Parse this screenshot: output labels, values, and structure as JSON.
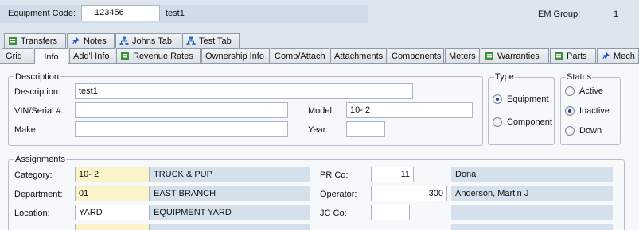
{
  "header": {
    "equipment_code_label": "Equipment Code:",
    "equipment_code_value": "123456",
    "equipment_name": "test1",
    "em_group_label": "EM Group:",
    "em_group_value": "1"
  },
  "tabs_row1": [
    {
      "label": "Transfers",
      "icon": "document-icon"
    },
    {
      "label": "Notes",
      "icon": "pin-icon"
    },
    {
      "label": "Johns Tab",
      "icon": "hierarchy-icon"
    },
    {
      "label": "Test Tab",
      "icon": "hierarchy-icon"
    }
  ],
  "tabs_row2": [
    {
      "label": "Grid",
      "icon": ""
    },
    {
      "label": "Info",
      "icon": "",
      "active": true
    },
    {
      "label": "Add'l Info",
      "icon": ""
    },
    {
      "label": "Revenue Rates",
      "icon": "document-icon"
    },
    {
      "label": "Ownership Info",
      "icon": ""
    },
    {
      "label": "Comp/Attach",
      "icon": ""
    },
    {
      "label": "Attachments",
      "icon": ""
    },
    {
      "label": "Components",
      "icon": ""
    },
    {
      "label": "Meters",
      "icon": ""
    },
    {
      "label": "Warranties",
      "icon": "document-icon"
    },
    {
      "label": "Parts",
      "icon": "document-icon"
    },
    {
      "label": "Mech",
      "icon": "pin-icon"
    }
  ],
  "description_section": {
    "title": "Description",
    "description_label": "Description:",
    "description_value": "test1",
    "vin_label": "VIN/Serial #:",
    "vin_value": "",
    "make_label": "Make:",
    "make_value": "",
    "model_label": "Model:",
    "model_value": "10-  2",
    "year_label": "Year:",
    "year_value": ""
  },
  "type_section": {
    "title": "Type",
    "options": [
      {
        "label": "Equipment",
        "selected": true
      },
      {
        "label": "Component",
        "selected": false
      }
    ]
  },
  "status_section": {
    "title": "Status",
    "options": [
      {
        "label": "Active",
        "selected": false
      },
      {
        "label": "Inactive",
        "selected": true
      },
      {
        "label": "Down",
        "selected": false
      }
    ]
  },
  "assignments": {
    "title": "Assignments",
    "category_label": "Category:",
    "category_value": "10-  2",
    "category_desc": "TRUCK & PUP",
    "department_label": "Department:",
    "department_value": "01",
    "department_desc": "EAST BRANCH",
    "location_label": "Location:",
    "location_value": "YARD",
    "location_desc": "EQUIPMENT YARD",
    "pr_co_label": "PR Co:",
    "pr_co_value": "11",
    "pr_co_desc": "Dona",
    "operator_label": "Operator:",
    "operator_value": "300",
    "operator_desc": "Anderson, Martin J",
    "jc_co_label": "JC Co:",
    "jc_co_value": "",
    "jc_co_desc": ""
  },
  "colors": {
    "background": "#dde6ef",
    "readonly_field": "#d4e1ec",
    "required_field": "#fbf3c9"
  }
}
